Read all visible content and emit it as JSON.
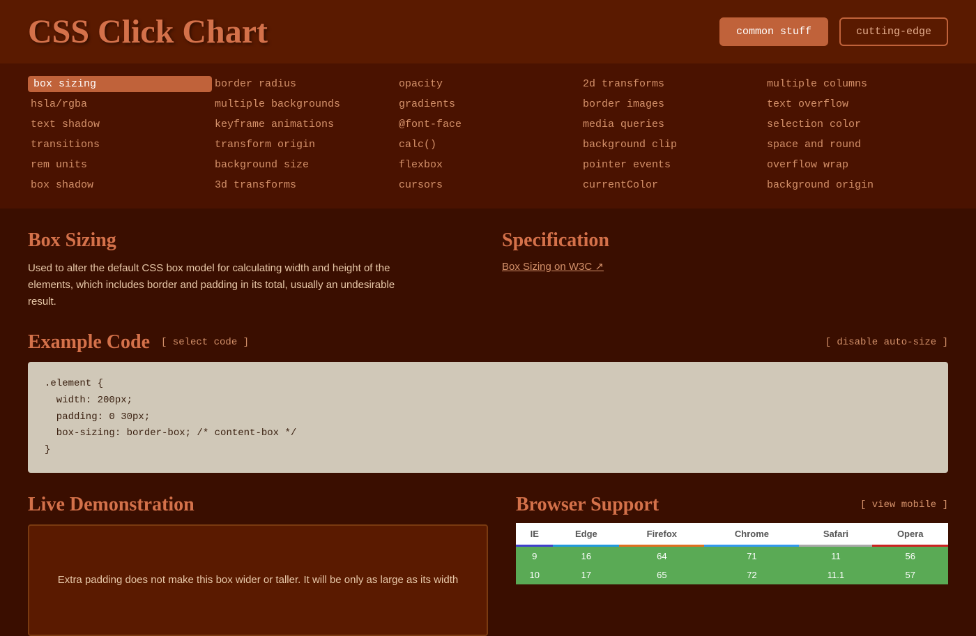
{
  "header": {
    "title": "CSS Click Chart",
    "buttons": [
      {
        "label": "common stuff",
        "active": true
      },
      {
        "label": "cutting-edge",
        "active": false
      }
    ]
  },
  "nav": {
    "items": [
      {
        "label": "box sizing",
        "active": true,
        "col": 0
      },
      {
        "label": "border radius",
        "active": false,
        "col": 1
      },
      {
        "label": "opacity",
        "active": false,
        "col": 2
      },
      {
        "label": "2d transforms",
        "active": false,
        "col": 3
      },
      {
        "label": "multiple columns",
        "active": false,
        "col": 4
      },
      {
        "label": "hsla/rgba",
        "active": false,
        "col": 0
      },
      {
        "label": "multiple backgrounds",
        "active": false,
        "col": 1
      },
      {
        "label": "gradients",
        "active": false,
        "col": 2
      },
      {
        "label": "border images",
        "active": false,
        "col": 3
      },
      {
        "label": "text overflow",
        "active": false,
        "col": 4
      },
      {
        "label": "text shadow",
        "active": false,
        "col": 0
      },
      {
        "label": "keyframe animations",
        "active": false,
        "col": 1
      },
      {
        "label": "@font-face",
        "active": false,
        "col": 2
      },
      {
        "label": "media queries",
        "active": false,
        "col": 3
      },
      {
        "label": "selection color",
        "active": false,
        "col": 4
      },
      {
        "label": "transitions",
        "active": false,
        "col": 0
      },
      {
        "label": "transform origin",
        "active": false,
        "col": 1
      },
      {
        "label": "calc()",
        "active": false,
        "col": 2
      },
      {
        "label": "background clip",
        "active": false,
        "col": 3
      },
      {
        "label": "space and round",
        "active": false,
        "col": 4
      },
      {
        "label": "rem units",
        "active": false,
        "col": 0
      },
      {
        "label": "background size",
        "active": false,
        "col": 1
      },
      {
        "label": "flexbox",
        "active": false,
        "col": 2
      },
      {
        "label": "pointer events",
        "active": false,
        "col": 3
      },
      {
        "label": "overflow wrap",
        "active": false,
        "col": 4
      },
      {
        "label": "box shadow",
        "active": false,
        "col": 0
      },
      {
        "label": "3d transforms",
        "active": false,
        "col": 1
      },
      {
        "label": "cursors",
        "active": false,
        "col": 2
      },
      {
        "label": "currentColor",
        "active": false,
        "col": 3
      },
      {
        "label": "background origin",
        "active": false,
        "col": 4
      }
    ]
  },
  "content": {
    "feature_title": "Box Sizing",
    "feature_description": "Used to alter the default CSS box model for calculating width and height of the elements, which includes border and padding in its total, usually an undesirable result.",
    "spec_title": "Specification",
    "spec_link_label": "Box Sizing on W3C ↗",
    "example_code_title": "Example Code",
    "select_code_label": "[ select code ]",
    "disable_auto_size_label": "[ disable auto-size ]",
    "code": ".element {\n  width: 200px;\n  padding: 0 30px;\n  box-sizing: border-box; /* content-box */\n}",
    "live_demo_title": "Live Demonstration",
    "demo_text": "Extra padding does not make this box wider or taller. It will be only as large as its width",
    "browser_support_title": "Browser Support",
    "view_mobile_label": "[ view mobile ]",
    "browser_headers": [
      "IE",
      "Edge",
      "Firefox",
      "Chrome",
      "Safari",
      "Opera"
    ],
    "browser_rows": [
      [
        "9",
        "16",
        "64",
        "71",
        "11",
        "56"
      ],
      [
        "10",
        "17",
        "65",
        "72",
        "11.1",
        "57"
      ]
    ]
  }
}
